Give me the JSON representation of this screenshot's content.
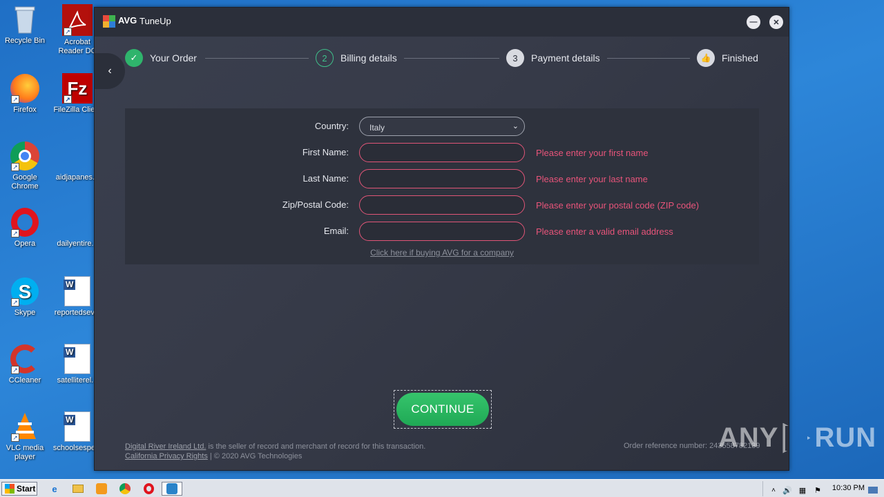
{
  "desktop": {
    "icons": [
      {
        "label": "Recycle Bin",
        "icon": "recycle-bin-icon"
      },
      {
        "label": "Acrobat Reader DC",
        "icon": "acrobat-icon"
      },
      {
        "label": "Firefox",
        "icon": "firefox-icon"
      },
      {
        "label": "FileZilla Client",
        "icon": "filezilla-icon"
      },
      {
        "label": "Google Chrome",
        "icon": "chrome-icon"
      },
      {
        "label": "aidjapanes...",
        "icon": "file-icon"
      },
      {
        "label": "Opera",
        "icon": "opera-icon"
      },
      {
        "label": "dailyentire...",
        "icon": "file-icon"
      },
      {
        "label": "Skype",
        "icon": "skype-icon"
      },
      {
        "label": "reportedsev...",
        "icon": "word-doc-icon"
      },
      {
        "label": "CCleaner",
        "icon": "ccleaner-icon"
      },
      {
        "label": "satelliterel...",
        "icon": "word-doc-icon"
      },
      {
        "label": "VLC media player",
        "icon": "vlc-icon"
      },
      {
        "label": "schoolsespe...",
        "icon": "word-doc-icon"
      }
    ]
  },
  "window": {
    "brand": "AVG",
    "product": "TuneUp",
    "minimize_label": "—",
    "close_label": "✕"
  },
  "steps": [
    {
      "number": "✓",
      "label": "Your Order",
      "state": "done"
    },
    {
      "number": "2",
      "label": "Billing details",
      "state": "active"
    },
    {
      "number": "3",
      "label": "Payment details",
      "state": "pending"
    },
    {
      "number": "👍",
      "label": "Finished",
      "state": "pending"
    }
  ],
  "form": {
    "country_label": "Country:",
    "country_value": "Italy",
    "first_name_label": "First Name:",
    "first_name_error": "Please enter your first name",
    "last_name_label": "Last Name:",
    "last_name_error": "Please enter your last name",
    "zip_label": "Zip/Postal Code:",
    "zip_error": "Please enter your postal code (ZIP code)",
    "email_label": "Email:",
    "email_error": "Please enter a valid email address",
    "company_link": "Click here if buying AVG for a company"
  },
  "continue_label": "CONTINUE",
  "footer": {
    "seller_link": "Digital River Ireland Ltd.",
    "seller_text": " is the seller of record and merchant of record for this transaction.",
    "privacy_link": "California Privacy Rights",
    "copyright": " | © 2020 AVG Technologies",
    "order_ref": "Order reference number: 243558782139"
  },
  "watermark": {
    "left": "ANY",
    "right": "RUN"
  },
  "taskbar": {
    "start_label": "Start",
    "clock": "10:30 PM"
  },
  "colors": {
    "accent_green": "#22b35e",
    "error": "#e8547a",
    "step_active": "#3fbf8a"
  }
}
